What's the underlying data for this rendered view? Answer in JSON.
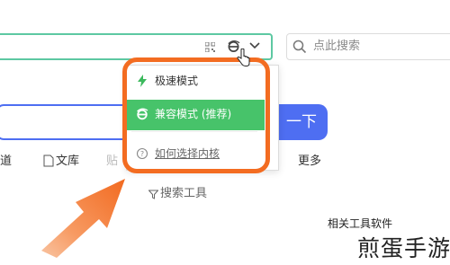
{
  "browser": {
    "search_placeholder": "点此搜索"
  },
  "engine_menu": {
    "items": [
      {
        "label": "极速模式",
        "icon": "lightning-icon",
        "selected": false
      },
      {
        "label": "兼容模式 (推荐)",
        "icon": "ie-icon",
        "selected": true
      },
      {
        "label": "如何选择内核",
        "icon": "help-icon",
        "selected": false
      }
    ]
  },
  "page": {
    "search_button_label": "一下",
    "nav": {
      "tieba": "道",
      "wenku": "文库",
      "faded": "贴",
      "more": "更多"
    },
    "tools_label": "搜索工具",
    "related_label": "相关工具软件"
  },
  "watermark": "煎蛋手游",
  "colors": {
    "accent_green": "#47c36a",
    "highlight_orange": "#f36c21",
    "search_blue": "#4e6ef2",
    "address_border": "#5dc8a2"
  }
}
